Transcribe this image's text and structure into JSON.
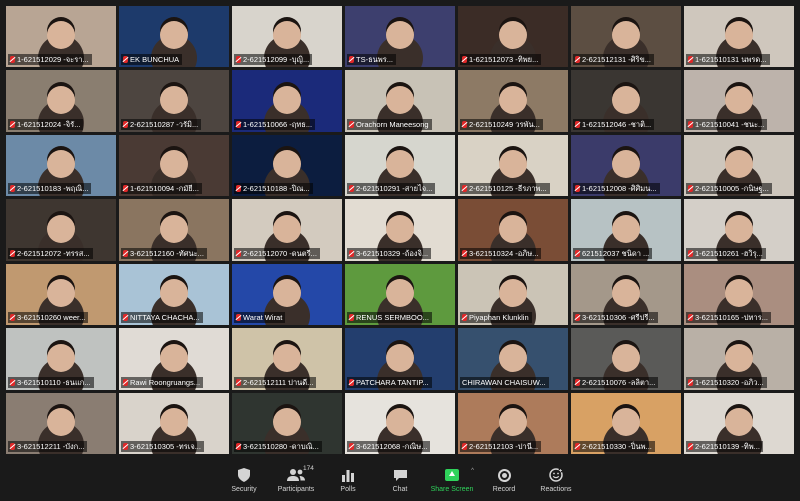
{
  "app": {
    "name": "Zoom Gallery View"
  },
  "accent": {
    "active_speaker": "#2dd92d",
    "share_green": "#2fd35b",
    "muted_red": "#e02828"
  },
  "tiles": [
    {
      "label": "1-621512029 -จะรา...",
      "bg": "#b8a594",
      "muted": true
    },
    {
      "label": "EK BUNCHUA",
      "bg": "#1d3a6b",
      "muted": true
    },
    {
      "label": "2-621512099 -บุญิ...",
      "bg": "#d8d4cc",
      "muted": true
    },
    {
      "label": "TS-ธนพร...",
      "bg": "#3d3f6e",
      "muted": true
    },
    {
      "label": "1-621512073 -ทิพย...",
      "bg": "#3b2c26",
      "muted": true
    },
    {
      "label": "2-621512131 -ศิริข...",
      "bg": "#5c4e42",
      "muted": true
    },
    {
      "label": "1-621510131 นพรด...",
      "bg": "#cfc7bd",
      "muted": true
    },
    {
      "label": "1-621512024 -จิรั...",
      "bg": "#8a7e70",
      "muted": true
    },
    {
      "label": "2-621510287 -วรัมิ...",
      "bg": "#4d4540",
      "muted": true
    },
    {
      "label": "1-621510066 -ฤทธ...",
      "bg": "#1b2a7a",
      "muted": true
    },
    {
      "label": "Orachorn Maneesong",
      "bg": "#c8c2b6",
      "muted": true
    },
    {
      "label": "2-621510249 วรพัน...",
      "bg": "#8d7a65",
      "muted": true
    },
    {
      "label": "1-621512046 -ชาติ...",
      "bg": "#3a3632",
      "muted": true
    },
    {
      "label": "1-621510041 -ชนะ...",
      "bg": "#bdb3ab",
      "muted": true
    },
    {
      "label": "2-621510183 -พฤณิ...",
      "bg": "#6c8aa7",
      "muted": true
    },
    {
      "label": "1-621510094 -กมัยี...",
      "bg": "#4a3a34",
      "muted": true
    },
    {
      "label": "2-621510188 -ปิณ...",
      "bg": "#0c1d3f",
      "muted": true
    },
    {
      "label": "2-621510291 -สายไจ...",
      "bg": "#d6d6ce",
      "muted": true
    },
    {
      "label": "2-621510125 -ธีรภาพ...",
      "bg": "#d9d2c5",
      "muted": true
    },
    {
      "label": "1-621512008 -ศิศิมน...",
      "bg": "#3b3b6a",
      "muted": true
    },
    {
      "label": "2-621510005 -กนิษฐ...",
      "bg": "#cdc6bc",
      "muted": true
    },
    {
      "label": "2-621512072 -ทรรส...",
      "bg": "#3e3630",
      "muted": true
    },
    {
      "label": "3-621512160 -ทัศนะ...",
      "bg": "#8a7560",
      "muted": true
    },
    {
      "label": "2-621512070 -ดนตรี...",
      "bg": "#d3cbbf",
      "muted": true
    },
    {
      "label": "3-621510329 -ถ้องจิ...",
      "bg": "#e2dcd2",
      "muted": true
    },
    {
      "label": "3-621510324 -อภิษ...",
      "bg": "#7a4d36",
      "muted": true
    },
    {
      "label": "621512037 ชนิดา ...",
      "bg": "#b7c2c4",
      "muted": true
    },
    {
      "label": "1-621510261 -ฮวิรุ...",
      "bg": "#d4cfc8",
      "muted": true
    },
    {
      "label": "3-621510260 weer...",
      "bg": "#c09970",
      "muted": true
    },
    {
      "label": "NITTAYA CHACHA...",
      "bg": "#a9c3d6",
      "muted": true
    },
    {
      "label": "Warat Wirat",
      "bg": "#2448a8",
      "muted": true
    },
    {
      "label": "RENUS SERMBOO...",
      "bg": "#5e9a3e",
      "muted": true
    },
    {
      "label": "Piyaphan Klunklin",
      "bg": "#cbc4b6",
      "muted": true
    },
    {
      "label": "3-621510306 -ศรีปรี...",
      "bg": "#a4988a",
      "muted": true
    },
    {
      "label": "3-621510165 -ปทาร...",
      "bg": "#aa8e80",
      "muted": true
    },
    {
      "label": "3-621510110 -ธนแก...",
      "bg": "#bfc2c0",
      "muted": true
    },
    {
      "label": "Rawi Roongruangs...",
      "bg": "#e0dbd5",
      "muted": true
    },
    {
      "label": "2-621512111 ปานดี...",
      "bg": "#cfc3a8",
      "muted": true
    },
    {
      "label": "PATCHARA TANTIP...",
      "bg": "#233e6e",
      "muted": true
    },
    {
      "label": "CHIRAWAN CHAISUW...",
      "bg": "#36506e",
      "muted": false,
      "active": true
    },
    {
      "label": "2-621510076 -ลลิตา...",
      "bg": "#5a5a58",
      "muted": true
    },
    {
      "label": "1-621510320 -อภิว...",
      "bg": "#b9b0a6",
      "muted": true
    },
    {
      "label": "3-621512211 -บังก...",
      "bg": "#8a7d72",
      "muted": true
    },
    {
      "label": "3-621510305 -ทรเจ...",
      "bg": "#d9d3cb",
      "muted": true
    },
    {
      "label": "3-621510280 -ดาบณิ...",
      "bg": "#2f3530",
      "muted": true
    },
    {
      "label": "3-621512068 -กณิษ...",
      "bg": "#e6e3dd",
      "muted": true
    },
    {
      "label": "2-621512103 -ปานี...",
      "bg": "#ad7b5b",
      "muted": true
    },
    {
      "label": "2-621510330 -ปิ่นพ...",
      "bg": "#d8a164",
      "muted": true
    },
    {
      "label": "2-621510139 -ทิพ...",
      "bg": "#ddd8d1",
      "muted": true
    }
  ],
  "toolbar": {
    "security": "Security",
    "participants": "Participants",
    "participants_count": "174",
    "polls": "Polls",
    "chat": "Chat",
    "share_screen": "Share Screen",
    "record": "Record",
    "reactions": "Reactions"
  },
  "icons": {
    "security": "shield-icon",
    "participants": "participants-icon",
    "polls": "polls-icon",
    "chat": "chat-icon",
    "share_screen": "share-screen-icon",
    "record": "record-icon",
    "reactions": "reactions-icon"
  }
}
